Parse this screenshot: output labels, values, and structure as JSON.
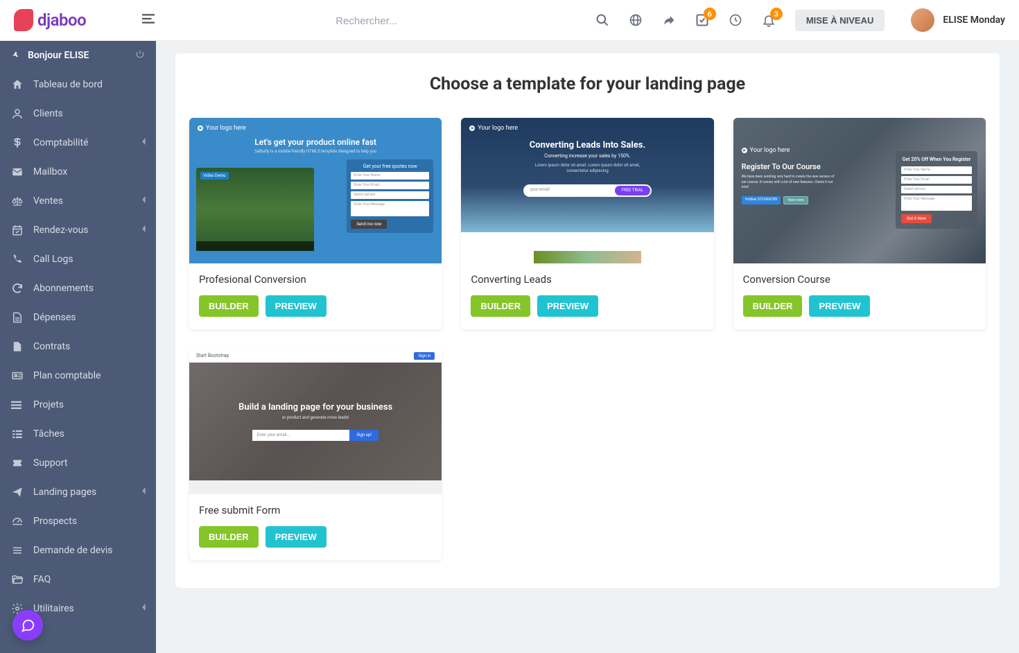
{
  "brand": "djaboo",
  "search": {
    "placeholder": "Rechercher..."
  },
  "header": {
    "upgrade_label": "MISE À NIVEAU",
    "user_name": "ELISE Monday",
    "check_badge": "6",
    "bell_badge": "3"
  },
  "sidebar": {
    "greeting": "Bonjour ELISE",
    "items": [
      {
        "label": "Tableau de bord",
        "expandable": false
      },
      {
        "label": "Clients",
        "expandable": false
      },
      {
        "label": "Comptabilité",
        "expandable": true
      },
      {
        "label": "Mailbox",
        "expandable": false
      },
      {
        "label": "Ventes",
        "expandable": true
      },
      {
        "label": "Rendez-vous",
        "expandable": true
      },
      {
        "label": "Call Logs",
        "expandable": false
      },
      {
        "label": "Abonnements",
        "expandable": false
      },
      {
        "label": "Dépenses",
        "expandable": false
      },
      {
        "label": "Contrats",
        "expandable": false
      },
      {
        "label": "Plan comptable",
        "expandable": false
      },
      {
        "label": "Projets",
        "expandable": false
      },
      {
        "label": "Tâches",
        "expandable": false
      },
      {
        "label": "Support",
        "expandable": false
      },
      {
        "label": "Landing pages",
        "expandable": true
      },
      {
        "label": "Prospects",
        "expandable": false
      },
      {
        "label": "Demande de devis",
        "expandable": false
      },
      {
        "label": "FAQ",
        "expandable": false
      },
      {
        "label": "Utilitaires",
        "expandable": true
      }
    ]
  },
  "page": {
    "title": "Choose a template for your landing page",
    "builder_label": "BUILDER",
    "preview_label": "PREVIEW",
    "templates": [
      {
        "title": "Profesional Conversion"
      },
      {
        "title": "Converting Leads"
      },
      {
        "title": "Conversion Course"
      },
      {
        "title": "Free submit Form"
      }
    ]
  },
  "thumbs": {
    "t1": {
      "logo": "Your logo here",
      "heading": "Let's get your product online fast",
      "sub": "Salbutly is a mobile-friendly HTML5 template designed to help you",
      "form_title": "Get your free quotes now",
      "f1": "Enter Your Name...",
      "f2": "Enter Your Email...",
      "f3": "Select service",
      "f4": "Enter Your Message",
      "btn": "Send me now",
      "video": "Video Demo"
    },
    "t2": {
      "logo": "Your logo here",
      "heading": "Converting Leads Into Sales.",
      "sub": "Converting increase your sales by 150%.",
      "desc": "Lorem ipsum dolor sit amet. Lorem ipsum dolor sit amet, consectetur adipiscing",
      "pill_txt": "your email",
      "pill_btn": "FREE TRIAL"
    },
    "t3": {
      "logo": "Your logo here",
      "heading": "Register To Our Course",
      "sub": "We have been working very hard to create the new version of our course. It comes with a lot of new features. Check it out now!",
      "tag1": "Hotline: 0123456789",
      "tag2": "View more",
      "form_title": "Get 20% Off When You Register",
      "f1": "Enter Your Name...",
      "f2": "Enter Your Email",
      "f3": "Select service",
      "f4": "Enter Your Message",
      "btn": "Get it Now"
    },
    "t4": {
      "brand": "Start Bootstrap",
      "signin": "Sign in",
      "heading": "Build a landing page for your business",
      "sub": "or product and generate more leads!",
      "input": "Enter your email...",
      "btn": "Sign up!"
    }
  }
}
